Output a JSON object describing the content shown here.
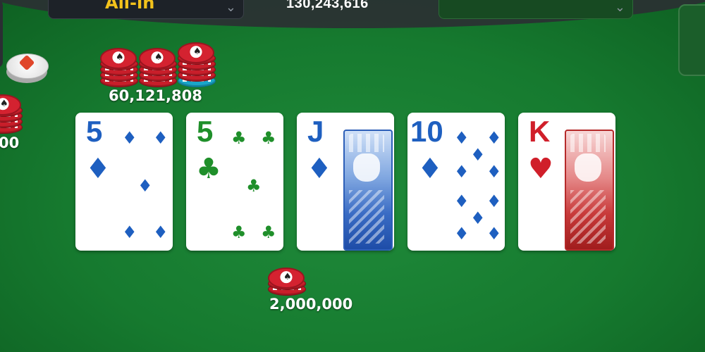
{
  "top_bar": {
    "action_dropdown_label": "All-in",
    "total_pot": "130,243,616"
  },
  "pot_chips": {
    "amount": "60,121,808"
  },
  "left_player_bet": {
    "amount": "00"
  },
  "bottom_bet": {
    "amount": "2,000,000"
  },
  "board_cards": [
    {
      "rank": "5",
      "suit": "diamonds",
      "suit_symbol": "♦",
      "color": "#1e5fc0"
    },
    {
      "rank": "5",
      "suit": "clubs",
      "suit_symbol": "♣",
      "color": "#1f8f2a"
    },
    {
      "rank": "J",
      "suit": "diamonds",
      "suit_symbol": "♦",
      "color": "#1e5fc0"
    },
    {
      "rank": "10",
      "suit": "diamonds",
      "suit_symbol": "♦",
      "color": "#1e5fc0"
    },
    {
      "rank": "K",
      "suit": "hearts",
      "suit_symbol": "♥",
      "color": "#d01f2a"
    }
  ],
  "colors": {
    "felt": "#167a2f",
    "action_label": "#f3c21b",
    "chip_red": "#c81e2a"
  },
  "icons": {
    "dealer_button": "dealer-button-icon",
    "chip": "poker-chip-icon",
    "dropdown": "chevron-down-icon"
  }
}
